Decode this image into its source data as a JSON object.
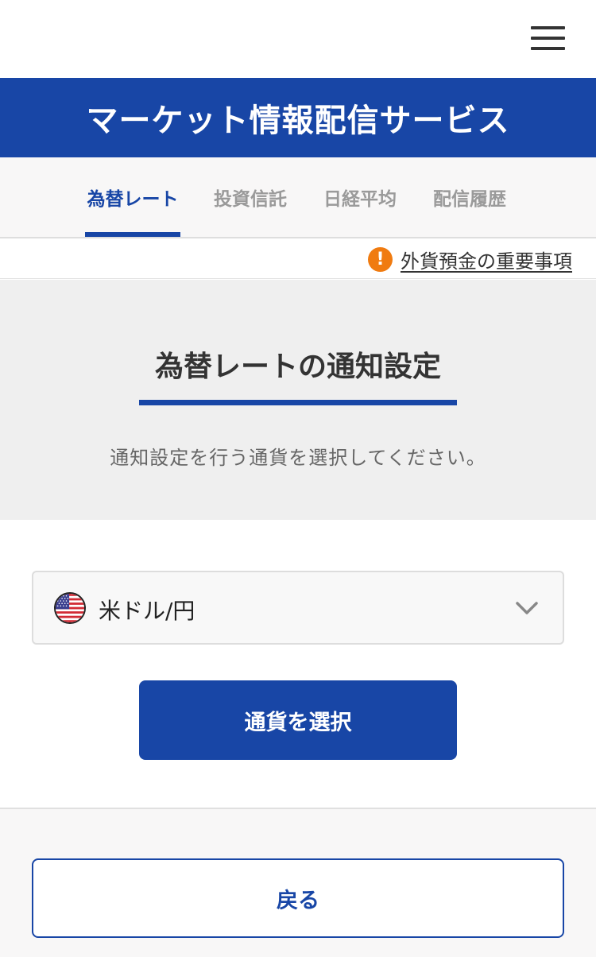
{
  "header": {
    "menu_icon": "hamburger-menu-icon"
  },
  "banner": {
    "title": "マーケット情報配信サービス"
  },
  "tabs": [
    {
      "label": "為替レート",
      "active": true
    },
    {
      "label": "投資信託",
      "active": false
    },
    {
      "label": "日経平均",
      "active": false
    },
    {
      "label": "配信履歴",
      "active": false
    }
  ],
  "notice": {
    "icon": "warning-icon",
    "icon_glyph": "!",
    "link_label": "外貨預金の重要事項"
  },
  "hero": {
    "title": "為替レートの通知設定",
    "description": "通知設定を行う通貨を選択してください。"
  },
  "currency_select": {
    "flag_icon": "us-flag-icon",
    "selected_value": "米ドル/円"
  },
  "actions": {
    "select_currency_label": "通貨を選択",
    "back_label": "戻る"
  },
  "colors": {
    "brand_blue": "#1846a6",
    "warning_orange": "#f07b10",
    "hero_background": "#efefef"
  }
}
